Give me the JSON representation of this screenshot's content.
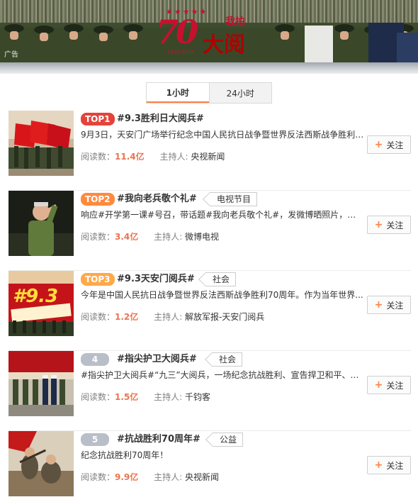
{
  "banner": {
    "ad_label": "广告",
    "logo_number": "70",
    "logo_years": "1945-2015",
    "logo_top": "我拍",
    "logo_main": "大阅兵"
  },
  "tabs": [
    {
      "label": "1小时",
      "active": true
    },
    {
      "label": "24小时",
      "active": false
    }
  ],
  "stats_labels": {
    "reads": "阅读数：",
    "host": "主持人: "
  },
  "follow_label": "关注",
  "topics": [
    {
      "rank": "TOP1",
      "title": "#9.3胜利日大阅兵#",
      "category": "",
      "desc": "9月3日，天安门广场举行纪念中国人民抗日战争暨世界反法西斯战争胜利7...",
      "reads": "11.4亿",
      "host": "央视新闻"
    },
    {
      "rank": "TOP2",
      "title": "#我向老兵敬个礼#",
      "category": "电视节目",
      "desc": "响应#开学第一课#号召，带话题#我向老兵敬个礼#，发微博晒照片，关爱...",
      "reads": "3.4亿",
      "host": "微博电视"
    },
    {
      "rank": "TOP3",
      "title": "#9.3天安门阅兵#",
      "category": "社会",
      "desc": "今年是中国人民抗日战争暨世界反法西斯战争胜利70周年。作为当年世界...",
      "reads": "1.2亿",
      "host": "解放军报-天安门阅兵"
    },
    {
      "rank": "4",
      "title": "#指尖护卫大阅兵#",
      "category": "社会",
      "desc": "#指尖护卫大阅兵#“九三”大阅兵，一场纪念抗战胜利、宣告捍卫和平、鼓...",
      "reads": "1.5亿",
      "host": "千钧客"
    },
    {
      "rank": "5",
      "title": "#抗战胜利70周年#",
      "category": "公益",
      "desc": "纪念抗战胜利70周年！",
      "reads": "9.9亿",
      "host": "央视新闻"
    }
  ]
}
